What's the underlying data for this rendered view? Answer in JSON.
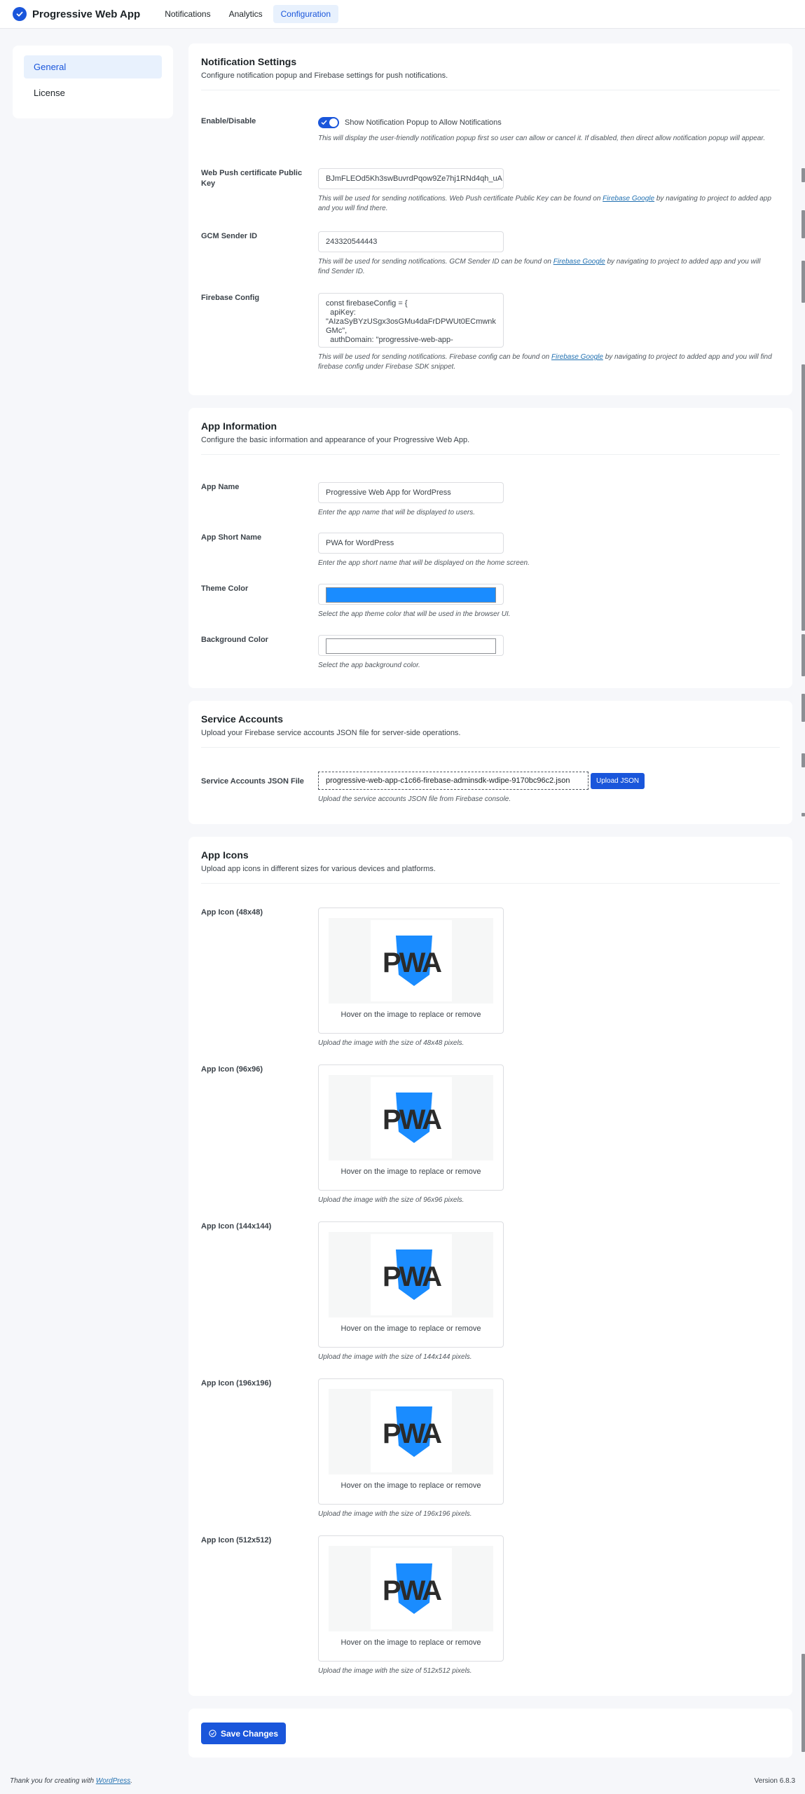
{
  "header": {
    "brand_title": "Progressive Web App",
    "nav": [
      "Notifications",
      "Analytics",
      "Configuration"
    ],
    "active_nav": "Configuration",
    "accent": "#1a56db"
  },
  "sidebar": {
    "items": [
      "General",
      "License"
    ],
    "active": "General"
  },
  "notification": {
    "title": "Notification Settings",
    "subtitle": "Configure notification popup and Firebase settings for push notifications.",
    "enable": {
      "label": "Enable/Disable",
      "checkbox_label": "Show Notification Popup to Allow Notifications",
      "checked": true,
      "help": "This will display the user-friendly notification popup first so user can allow or cancel it. If disabled, then direct allow notification popup will appear."
    },
    "push_key": {
      "label": "Web Push certificate Public Key",
      "value": "BJmFLEOd5Kh3swBuvrdPqow9Ze7hj1RNd4qh_uA",
      "help_before": "This will be used for sending notifications. Web Push certificate Public Key can be found on ",
      "help_link": "Firebase Google",
      "help_after": " by navigating to project to added app and you will find there."
    },
    "gcm": {
      "label": "GCM Sender ID",
      "value": "243320544443",
      "help_before": "This will be used for sending notifications. GCM Sender ID can be found on ",
      "help_link": "Firebase Google",
      "help_after": " by navigating to project to added app and you will find Sender ID."
    },
    "firebase": {
      "label": "Firebase Config",
      "value": "const firebaseConfig = {\n  apiKey:\n\"AIzaSyBYzUSgx3osGMu4daFrDPWUt0ECmwnkGMc\",\n  authDomain: \"progressive-web-app-",
      "help_before": "This will be used for sending notifications. Firebase config can be found on ",
      "help_link": "Firebase Google",
      "help_after": " by navigating to project to added app and you will find firebase config under Firebase SDK snippet."
    }
  },
  "app_info": {
    "title": "App Information",
    "subtitle": "Configure the basic information and appearance of your Progressive Web App.",
    "name": {
      "label": "App Name",
      "value": "Progressive Web App for WordPress",
      "help": "Enter the app name that will be displayed to users."
    },
    "short_name": {
      "label": "App Short Name",
      "value": "PWA for WordPress",
      "help": "Enter the app short name that will be displayed on the home screen."
    },
    "theme_color": {
      "label": "Theme Color",
      "value": "#1a8cff",
      "help": "Select the app theme color that will be used in the browser UI."
    },
    "background_color": {
      "label": "Background Color",
      "value": "#ffffff",
      "help": "Select the app background color."
    }
  },
  "service_accounts": {
    "title": "Service Accounts",
    "subtitle": "Upload your Firebase service accounts JSON file for server-side operations.",
    "label": "Service Accounts JSON File",
    "file_name": "progressive-web-app-c1c66-firebase-adminsdk-wdipe-9170bc96c2.json",
    "button": "Upload JSON",
    "help": "Upload the service accounts JSON file from Firebase console."
  },
  "icons": {
    "title": "App Icons",
    "subtitle": "Upload app icons in different sizes for various devices and platforms.",
    "items": [
      {
        "label": "App Icon (48x48)",
        "caption": "Hover on the image to replace or remove",
        "help": "Upload the image with the size of 48x48 pixels."
      },
      {
        "label": "App Icon (96x96)",
        "caption": "Hover on the image to replace or remove",
        "help": "Upload the image with the size of 96x96 pixels."
      },
      {
        "label": "App Icon (144x144)",
        "caption": "Hover on the image to replace or remove",
        "help": "Upload the image with the size of 144x144 pixels."
      },
      {
        "label": "App Icon (196x196)",
        "caption": "Hover on the image to replace or remove",
        "help": "Upload the image with the size of 196x196 pixels."
      },
      {
        "label": "App Icon (512x512)",
        "caption": "Hover on the image to replace or remove",
        "help": "Upload the image with the size of 512x512 pixels."
      }
    ],
    "logo_text": "PWA",
    "logo_colors": {
      "dark": "#2b2b2b",
      "blue": "#1a8cff"
    }
  },
  "save": {
    "label": "Save Changes"
  },
  "footer": {
    "thanks_before": "Thank you for creating with ",
    "thanks_link": "WordPress",
    "thanks_after": ".",
    "version": "Version 6.8.3"
  }
}
